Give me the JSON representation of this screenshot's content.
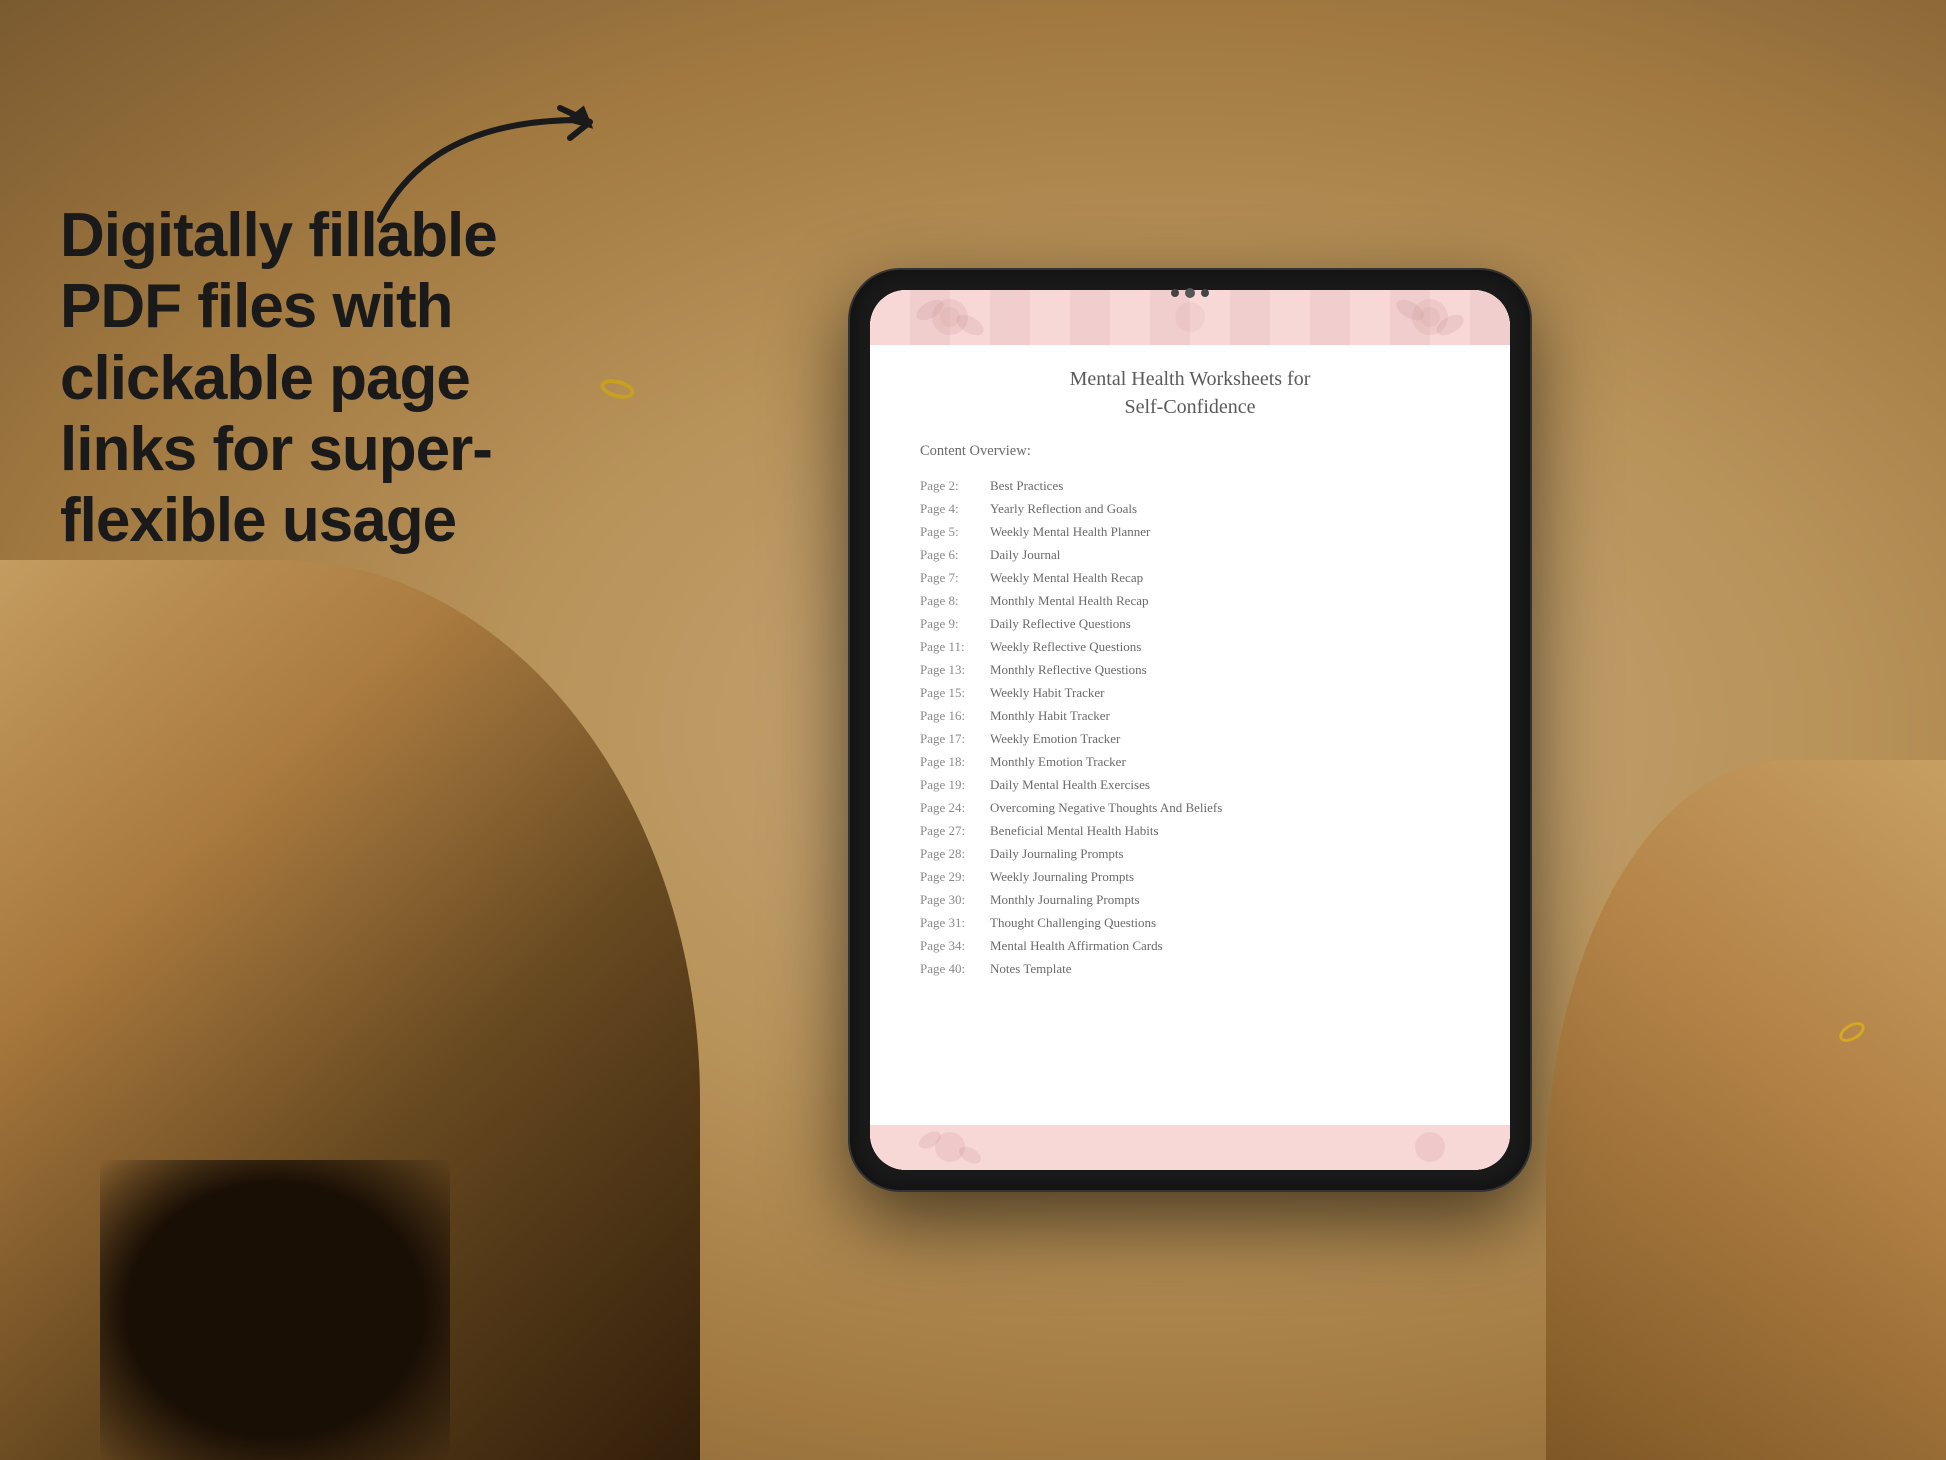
{
  "background": {
    "color": "#c4a882"
  },
  "left_text": {
    "headline": "Digitally fillable PDF files with clickable page links for super-flexible usage"
  },
  "arrow": {
    "description": "curved arrow pointing right toward tablet"
  },
  "tablet": {
    "title_line1": "Mental Health Worksheets for",
    "title_line2": "Self-Confidence",
    "content_overview_label": "Content Overview:",
    "toc_items": [
      {
        "page": "Page 2:",
        "title": "Best Practices"
      },
      {
        "page": "Page 4:",
        "title": "Yearly Reflection and Goals"
      },
      {
        "page": "Page 5:",
        "title": "Weekly Mental Health Planner"
      },
      {
        "page": "Page 6:",
        "title": "Daily Journal"
      },
      {
        "page": "Page 7:",
        "title": "Weekly Mental Health Recap"
      },
      {
        "page": "Page 8:",
        "title": "Monthly Mental Health Recap"
      },
      {
        "page": "Page 9:",
        "title": "Daily Reflective Questions"
      },
      {
        "page": "Page 11:",
        "title": "Weekly Reflective Questions"
      },
      {
        "page": "Page 13:",
        "title": "Monthly Reflective Questions"
      },
      {
        "page": "Page 15:",
        "title": "Weekly Habit Tracker"
      },
      {
        "page": "Page 16:",
        "title": "Monthly Habit Tracker"
      },
      {
        "page": "Page 17:",
        "title": "Weekly Emotion Tracker"
      },
      {
        "page": "Page 18:",
        "title": "Monthly Emotion Tracker"
      },
      {
        "page": "Page 19:",
        "title": "Daily Mental Health Exercises"
      },
      {
        "page": "Page 24:",
        "title": "Overcoming Negative Thoughts And Beliefs"
      },
      {
        "page": "Page 27:",
        "title": "Beneficial Mental Health Habits"
      },
      {
        "page": "Page 28:",
        "title": "Daily Journaling Prompts"
      },
      {
        "page": "Page 29:",
        "title": "Weekly Journaling Prompts"
      },
      {
        "page": "Page 30:",
        "title": "Monthly Journaling Prompts"
      },
      {
        "page": "Page 31:",
        "title": "Thought Challenging Questions"
      },
      {
        "page": "Page 34:",
        "title": "Mental Health Affirmation Cards"
      },
      {
        "page": "Page 40:",
        "title": "Notes Template"
      }
    ]
  }
}
